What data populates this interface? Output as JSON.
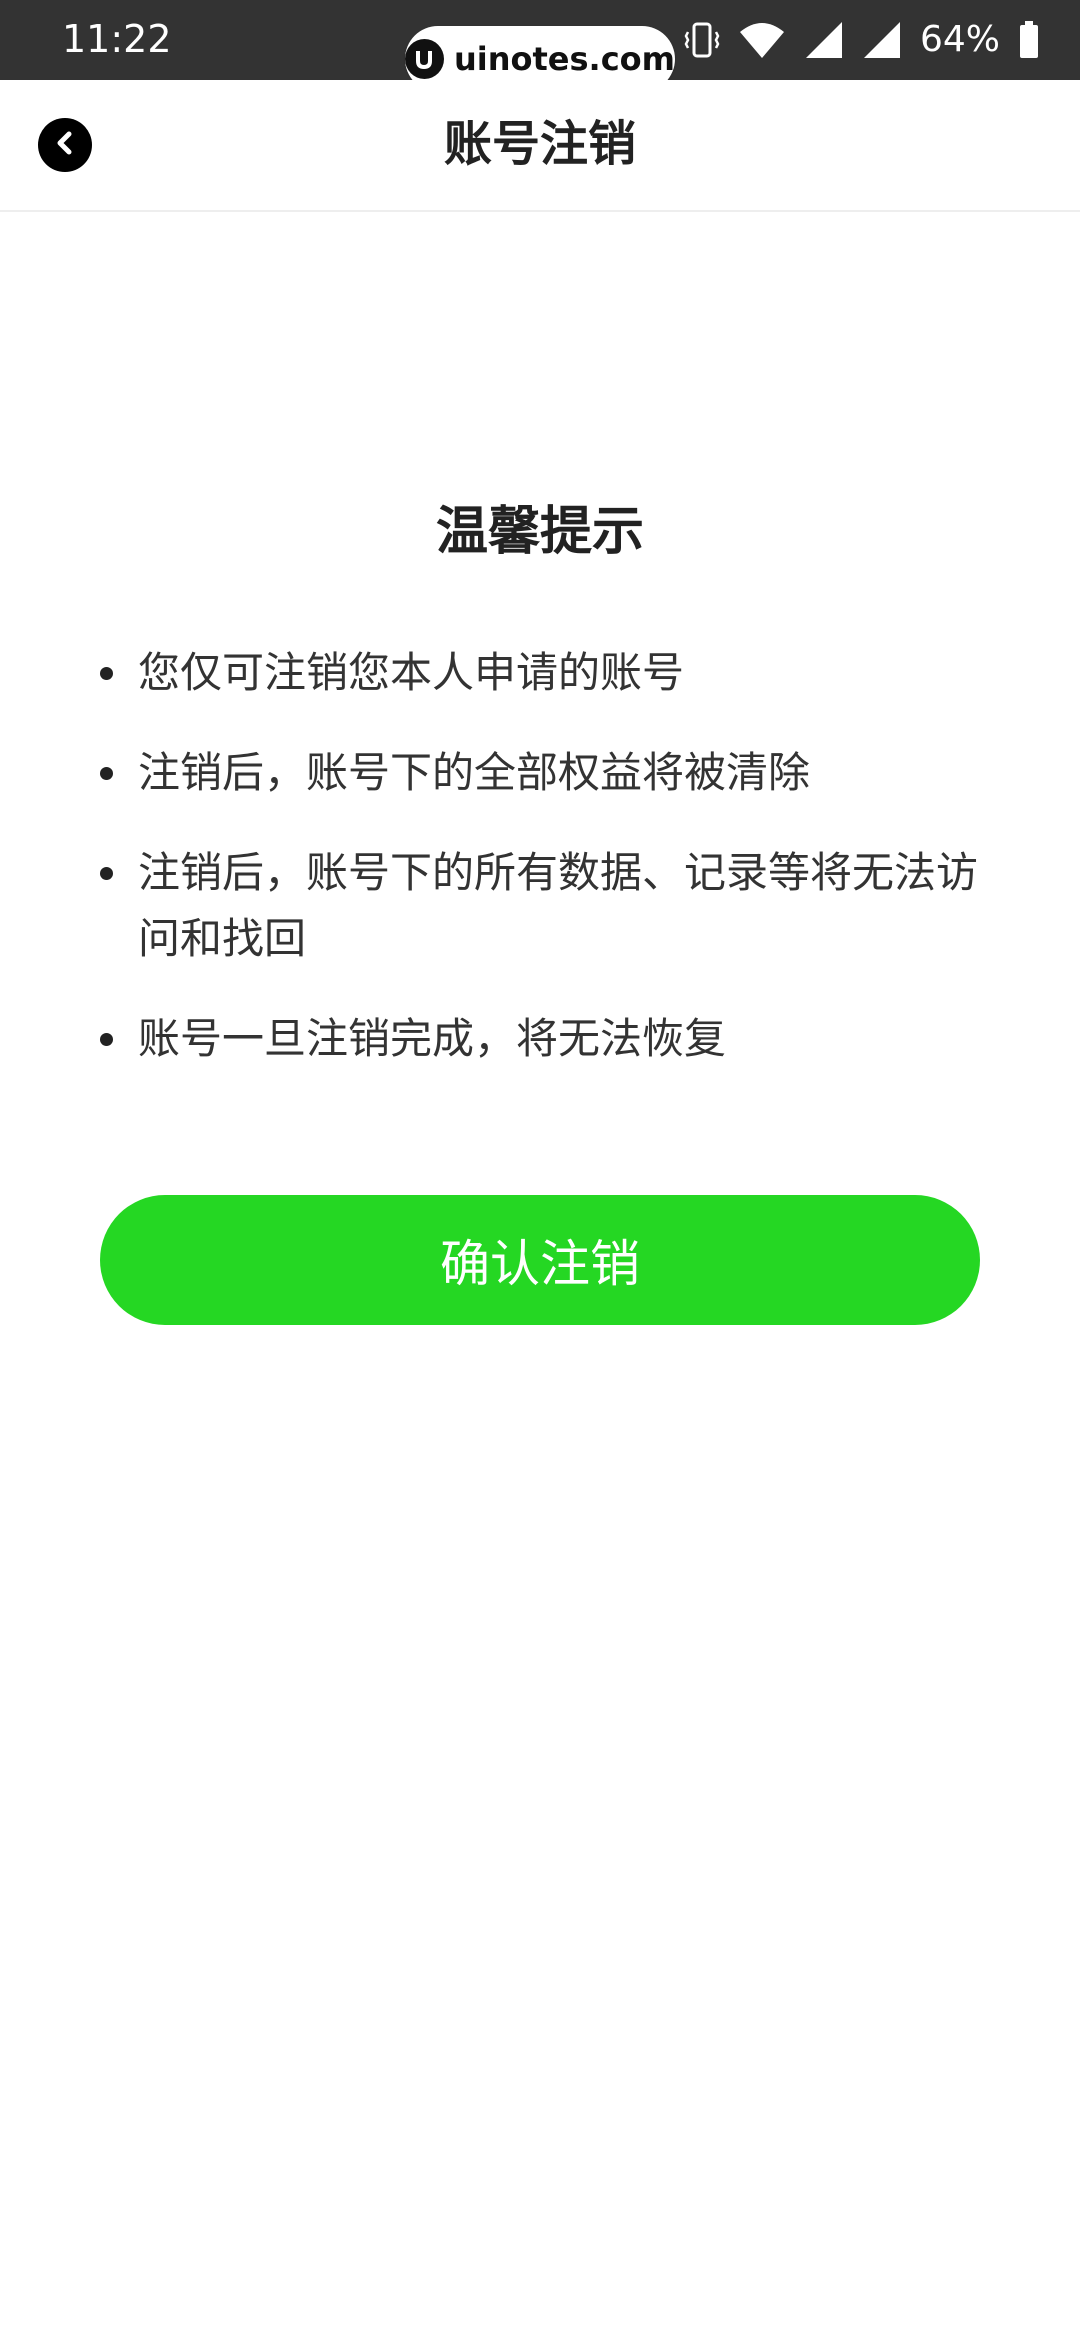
{
  "status_bar": {
    "time": "11:22",
    "battery": "64%",
    "icons": [
      "vibrate-icon",
      "wifi-icon",
      "signal-icon",
      "signal-icon",
      "battery-icon"
    ]
  },
  "watermark": {
    "text": "uinotes.com"
  },
  "nav": {
    "title": "账号注销",
    "back_icon": "chevron-left-icon"
  },
  "tips": {
    "title": "温馨提示",
    "items": [
      "您仅可注销您本人申请的账号",
      "注销后，账号下的全部权益将被清除",
      "注销后，账号下的所有数据、记录等将无法访问和找回",
      "账号一旦注销完成，将无法恢复"
    ]
  },
  "confirm_button": {
    "label": "确认注销",
    "color": "#25d723"
  },
  "colors": {
    "status_bar_bg": "#333333",
    "accent_green": "#25d723",
    "text": "#222222"
  }
}
